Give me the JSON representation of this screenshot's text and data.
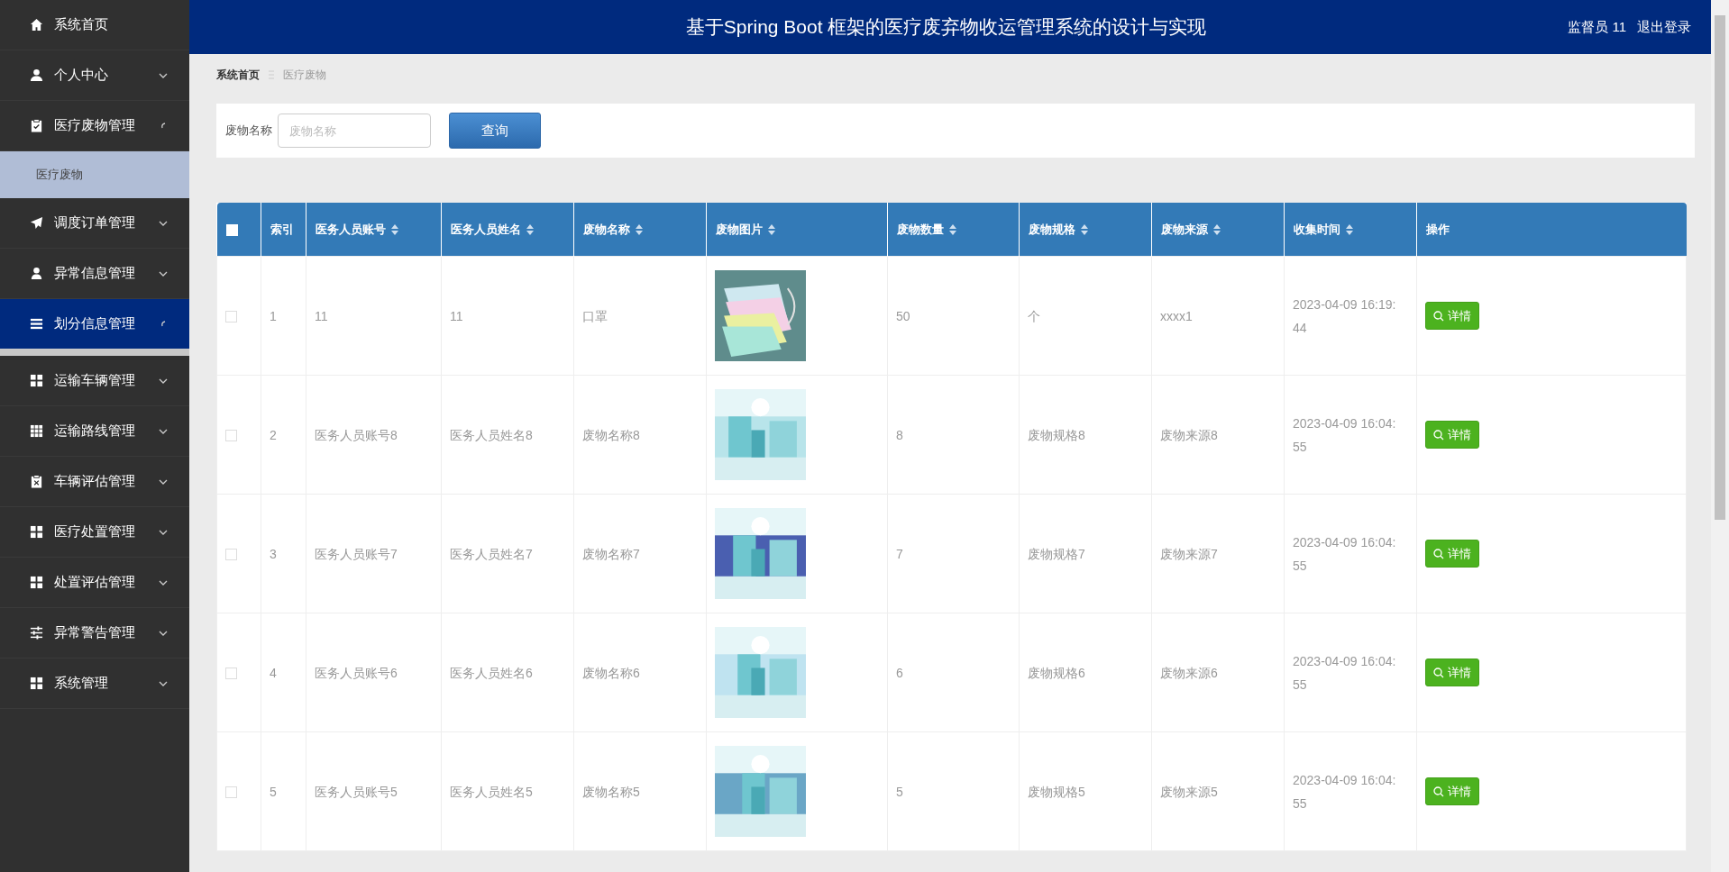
{
  "header": {
    "title": "基于Spring Boot 框架的医疗废弃物收运管理系统的设计与实现",
    "user": "监督员 11",
    "logout": "退出登录"
  },
  "sidebar": {
    "items": [
      {
        "label": "系统首页",
        "highlighted": false
      },
      {
        "label": "个人中心",
        "expanded": false,
        "highlighted": false
      },
      {
        "label": "医疗废物管理",
        "expanded": true,
        "highlighted": false,
        "children": [
          {
            "label": "医疗废物",
            "selected": true
          }
        ]
      },
      {
        "label": "调度订单管理",
        "expanded": false,
        "highlighted": false
      },
      {
        "label": "异常信息管理",
        "expanded": false,
        "highlighted": false
      },
      {
        "label": "划分信息管理",
        "expanded": true,
        "highlighted": true
      },
      {
        "label": "运输车辆管理",
        "expanded": false,
        "highlighted": false
      },
      {
        "label": "运输路线管理",
        "expanded": false,
        "highlighted": false
      },
      {
        "label": "车辆评估管理",
        "expanded": false,
        "highlighted": false
      },
      {
        "label": "医疗处置管理",
        "expanded": false,
        "highlighted": false
      },
      {
        "label": "处置评估管理",
        "expanded": false,
        "highlighted": false
      },
      {
        "label": "异常警告管理",
        "expanded": false,
        "highlighted": false
      },
      {
        "label": "系统管理",
        "expanded": false,
        "highlighted": false
      }
    ]
  },
  "breadcrumb": [
    {
      "label": "系统首页"
    },
    {
      "label": "医疗废物"
    }
  ],
  "search": {
    "label": "废物名称",
    "placeholder": "废物名称",
    "button": "查询"
  },
  "table": {
    "select_all": false,
    "columns": [
      {
        "label": "索引",
        "sortable": false
      },
      {
        "label": "医务人员账号",
        "sortable": true
      },
      {
        "label": "医务人员姓名",
        "sortable": true
      },
      {
        "label": "废物名称",
        "sortable": true
      },
      {
        "label": "废物图片",
        "sortable": true
      },
      {
        "label": "废物数量",
        "sortable": true
      },
      {
        "label": "废物规格",
        "sortable": true
      },
      {
        "label": "废物来源",
        "sortable": true
      },
      {
        "label": "收集时间",
        "sortable": true
      },
      {
        "label": "操作",
        "sortable": false
      }
    ],
    "rows": [
      {
        "checked": false,
        "index": "1",
        "account": "11",
        "name": "11",
        "waste": "口罩",
        "quantity": "50",
        "spec": "个",
        "source": "xxxx1",
        "time": "2023-04-09 16:19:44",
        "action": "详情"
      },
      {
        "checked": false,
        "index": "2",
        "account": "医务人员账号8",
        "name": "医务人员姓名8",
        "waste": "废物名称8",
        "quantity": "8",
        "spec": "废物规格8",
        "source": "废物来源8",
        "time": "2023-04-09 16:04:55",
        "action": "详情"
      },
      {
        "checked": false,
        "index": "3",
        "account": "医务人员账号7",
        "name": "医务人员姓名7",
        "waste": "废物名称7",
        "quantity": "7",
        "spec": "废物规格7",
        "source": "废物来源7",
        "time": "2023-04-09 16:04:55",
        "action": "详情"
      },
      {
        "checked": false,
        "index": "4",
        "account": "医务人员账号6",
        "name": "医务人员姓名6",
        "waste": "废物名称6",
        "quantity": "6",
        "spec": "废物规格6",
        "source": "废物来源6",
        "time": "2023-04-09 16:04:55",
        "action": "详情"
      },
      {
        "checked": false,
        "index": "5",
        "account": "医务人员账号5",
        "name": "医务人员姓名5",
        "waste": "废物名称5",
        "quantity": "5",
        "spec": "废物规格5",
        "source": "废物来源5",
        "time": "2023-04-09 16:04:55",
        "action": "详情"
      }
    ]
  }
}
